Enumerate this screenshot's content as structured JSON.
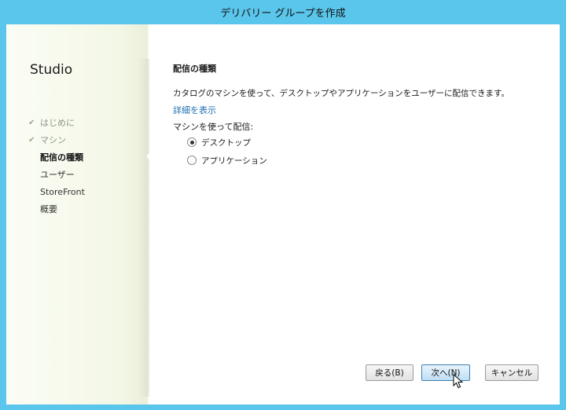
{
  "window": {
    "title": "デリバリー グループを作成"
  },
  "sidebar": {
    "brand": "Studio",
    "steps": [
      {
        "label": "はじめに",
        "status": "done"
      },
      {
        "label": "マシン",
        "status": "done"
      },
      {
        "label": "配信の種類",
        "status": "active"
      },
      {
        "label": "ユーザー",
        "status": "pending"
      },
      {
        "label": "StoreFront",
        "status": "pending"
      },
      {
        "label": "概要",
        "status": "pending"
      }
    ]
  },
  "main": {
    "section_title": "配信の種類",
    "description": "カタログのマシンを使って、デスクトップやアプリケーションをユーザーに配信できます。",
    "details_link": "詳細を表示",
    "deliver_label": "マシンを使って配信:",
    "options": [
      {
        "label": "デスクトップ",
        "selected": true
      },
      {
        "label": "アプリケーション",
        "selected": false
      }
    ]
  },
  "buttons": {
    "back": "戻る(B)",
    "next": "次へ(N)",
    "cancel": "キャンセル"
  },
  "colors": {
    "title_bar": "#5bc6ec",
    "link": "#1e6fb0",
    "primary_button_border": "#3c7fb1"
  }
}
